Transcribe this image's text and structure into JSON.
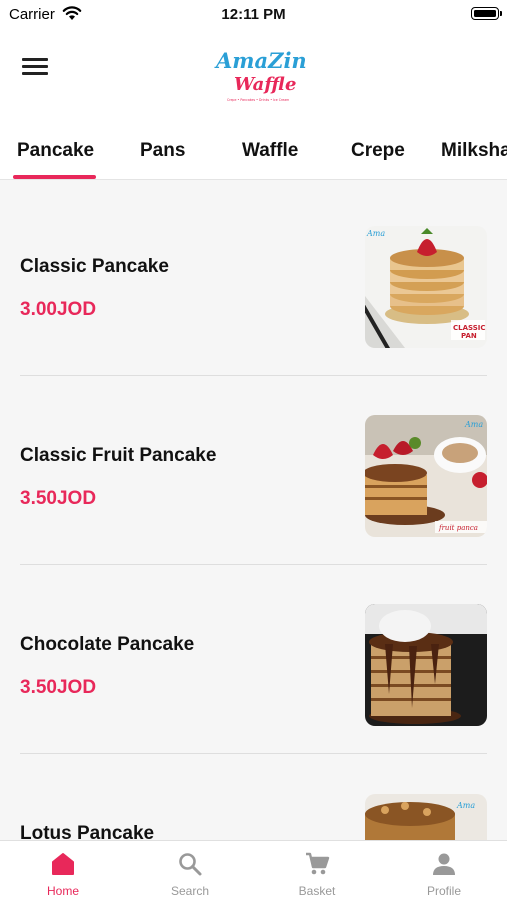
{
  "status_bar": {
    "carrier": "Carrier",
    "time": "12:11 PM"
  },
  "header": {
    "logo_line1": "AmaZing",
    "logo_line2": "Waffle",
    "logo_tagline": "Crepe • Pancakes • Drinks • Ice Cream"
  },
  "tabs": [
    {
      "label": "Pancake",
      "active": true
    },
    {
      "label": "Pans",
      "active": false
    },
    {
      "label": "Waffle",
      "active": false
    },
    {
      "label": "Crepe",
      "active": false
    },
    {
      "label": "Milkshake",
      "active": false
    }
  ],
  "items": [
    {
      "name": "Classic Pancake",
      "price": "3.00JOD",
      "image": "classic-pancake-photo"
    },
    {
      "name": "Classic Fruit Pancake",
      "price": "3.50JOD",
      "image": "fruit-pancake-photo"
    },
    {
      "name": "Chocolate Pancake",
      "price": "3.50JOD",
      "image": "chocolate-pancake-photo"
    },
    {
      "name": "Lotus Pancake",
      "price": "",
      "image": "lotus-pancake-photo"
    }
  ],
  "bottom_nav": [
    {
      "label": "Home",
      "icon": "home-icon",
      "active": true
    },
    {
      "label": "Search",
      "icon": "search-icon",
      "active": false
    },
    {
      "label": "Basket",
      "icon": "cart-icon",
      "active": false
    },
    {
      "label": "Profile",
      "icon": "profile-icon",
      "active": false
    }
  ],
  "colors": {
    "accent": "#e8285a",
    "inactive": "#999999",
    "background": "#f6f6f6"
  }
}
